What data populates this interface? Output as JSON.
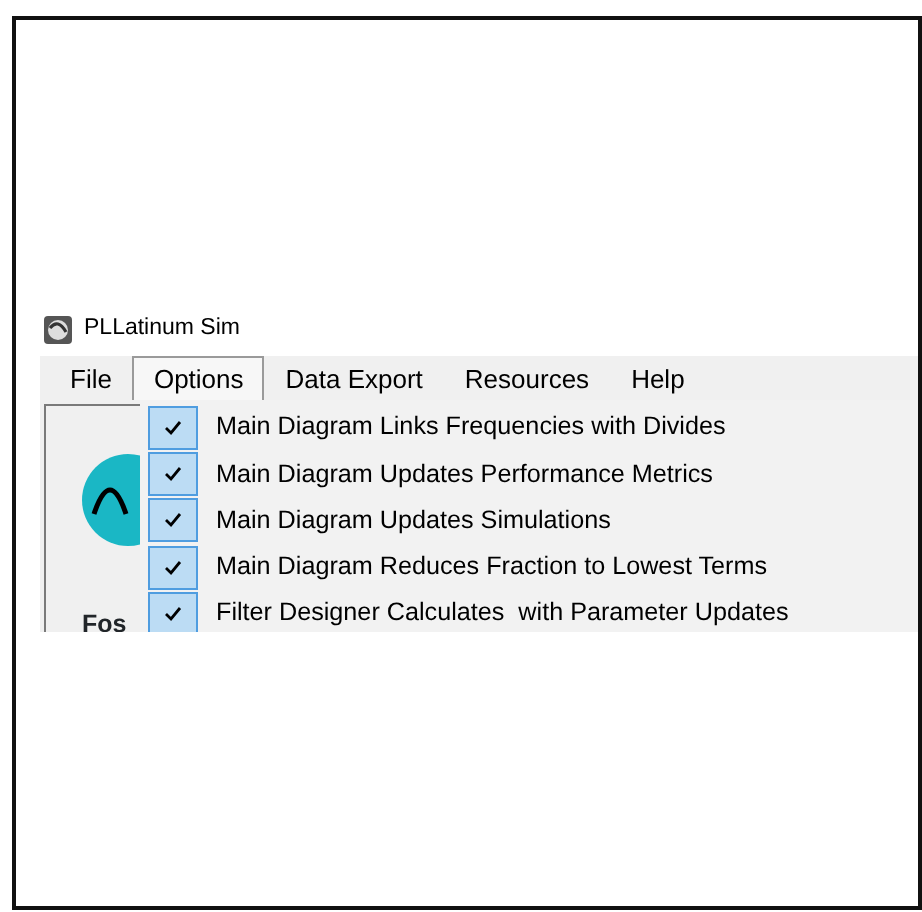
{
  "window": {
    "title": "PLLatinum Sim"
  },
  "menu": [
    {
      "label": "File",
      "selected": false
    },
    {
      "label": "Options",
      "selected": true
    },
    {
      "label": "Data Export",
      "selected": false
    },
    {
      "label": "Resources",
      "selected": false
    },
    {
      "label": "Help",
      "selected": false
    }
  ],
  "options_menu": [
    {
      "label": "Main Diagram Links Frequencies with Divides",
      "checked": true
    },
    {
      "label": "Main Diagram Updates Performance Metrics",
      "checked": true
    },
    {
      "label": "Main Diagram Updates Simulations",
      "checked": true
    },
    {
      "label": "Main Diagram Reduces Fraction to Lowest Terms",
      "checked": true
    },
    {
      "label": "Filter Designer Calculates  with Parameter Updates",
      "checked": true
    }
  ],
  "panel": {
    "label": "Fos"
  }
}
